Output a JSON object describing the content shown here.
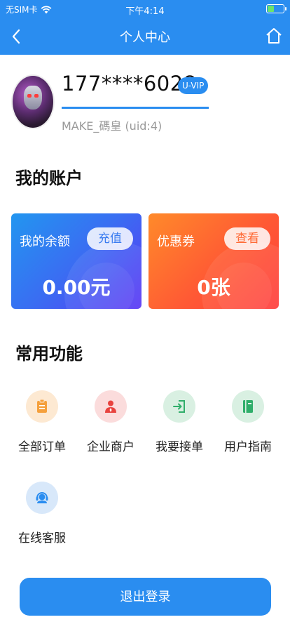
{
  "status_bar": {
    "carrier": "无SIM卡",
    "time": "下午4:14"
  },
  "nav": {
    "title": "个人中心"
  },
  "profile": {
    "phone": "177****6028",
    "vip_badge": "U-VIP",
    "user_line": "MAKE_碼皇 (uid:4)"
  },
  "account": {
    "section_title": "我的账户",
    "balance": {
      "label": "我的余额",
      "action": "充值",
      "value": "0.00元"
    },
    "coupon": {
      "label": "优惠券",
      "action": "查看",
      "value": "0张"
    }
  },
  "functions": {
    "section_title": "常用功能",
    "items": [
      {
        "label": "全部订单",
        "icon": "clipboard-icon",
        "bg": "#fde9d2",
        "color": "#f5a03c"
      },
      {
        "label": "企业商户",
        "icon": "merchant-icon",
        "bg": "#fbdcdc",
        "color": "#e8433f"
      },
      {
        "label": "我要接单",
        "icon": "login-icon",
        "bg": "#d9f0e2",
        "color": "#2fae6a"
      },
      {
        "label": "用户指南",
        "icon": "book-icon",
        "bg": "#d9f0e2",
        "color": "#2fae6a"
      },
      {
        "label": "在线客服",
        "icon": "customer-service-icon",
        "bg": "#d8e8fa",
        "color": "#2a8df0"
      }
    ]
  },
  "logout_label": "退出登录",
  "colors": {
    "primary": "#2a8df0"
  }
}
